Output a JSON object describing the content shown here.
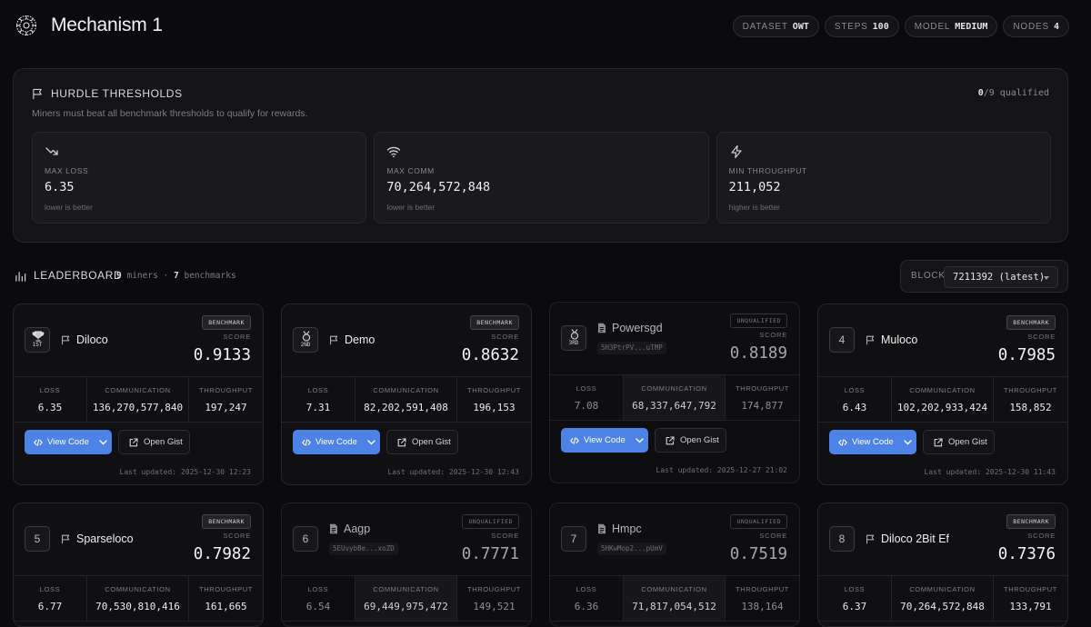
{
  "app": {
    "title": "Mechanism 1"
  },
  "pills": [
    {
      "label": "DATASET",
      "value": "OWT"
    },
    {
      "label": "STEPS",
      "value": "100"
    },
    {
      "label": "MODEL",
      "value": "MEDIUM"
    },
    {
      "label": "NODES",
      "value": "4"
    }
  ],
  "hurdle": {
    "title": "HURDLE THRESHOLDS",
    "description": "Miners must beat all benchmark thresholds to qualify for rewards.",
    "qualified_count": "0",
    "qualified_rest": "/9 qualified",
    "thresholds": [
      {
        "icon": "trending-down-icon",
        "label": "MAX LOSS",
        "value": "6.35",
        "hint": "lower is better"
      },
      {
        "icon": "wifi-icon",
        "label": "MAX COMM",
        "value": "70,264,572,848",
        "hint": "lower is better"
      },
      {
        "icon": "lightning-icon",
        "label": "MIN THROUGHPUT",
        "value": "211,052",
        "hint": "higher is better"
      }
    ]
  },
  "leaderboard": {
    "title": "LEADERBOARD",
    "miners_count": "9",
    "miners_label": "miners",
    "separator": "·",
    "benchmarks_count": "7",
    "benchmarks_label": "benchmarks",
    "block_label": "BLOCK",
    "block_value": "7211392 (latest)",
    "metric_labels": {
      "loss": "LOSS",
      "comm": "COMMUNICATION",
      "throughput": "THROUGHPUT"
    },
    "score_label": "SCORE",
    "view_code_label": "View Code",
    "open_gist_label": "Open Gist",
    "cards": [
      {
        "rank": "1ST",
        "name": "Diloco",
        "badge": "BENCHMARK",
        "score": "0.9133",
        "loss": "6.35",
        "comm": "136,270,577,840",
        "throughput": "197,247",
        "updated": "Last updated: 2025-12-30 12:23"
      },
      {
        "rank": "2ND",
        "name": "Demo",
        "badge": "BENCHMARK",
        "score": "0.8632",
        "loss": "7.31",
        "comm": "82,202,591,408",
        "throughput": "196,153",
        "updated": "Last updated: 2025-12-30 12:43"
      },
      {
        "rank": "3RD",
        "name": "Powersgd",
        "address": "5H3PtrPV...uTMP",
        "badge": "UNQUALIFIED",
        "score": "0.8189",
        "loss": "7.08",
        "comm": "68,337,647,792",
        "throughput": "174,877",
        "updated": "Last updated: 2025-12-27 21:02"
      },
      {
        "rank": "4",
        "name": "Muloco",
        "badge": "BENCHMARK",
        "score": "0.7985",
        "loss": "6.43",
        "comm": "102,202,933,424",
        "throughput": "158,852",
        "updated": "Last updated: 2025-12-30 11:43"
      },
      {
        "rank": "5",
        "name": "Sparseloco",
        "badge": "BENCHMARK",
        "score": "0.7982",
        "loss": "6.77",
        "comm": "70,530,810,416",
        "throughput": "161,665"
      },
      {
        "rank": "6",
        "name": "Aagp",
        "address": "5EUvybBe...xoZD",
        "badge": "UNQUALIFIED",
        "score": "0.7771",
        "loss": "6.54",
        "comm": "69,449,975,472",
        "throughput": "149,521"
      },
      {
        "rank": "7",
        "name": "Hmpc",
        "address": "5HKwMop2...pUmV",
        "badge": "UNQUALIFIED",
        "score": "0.7519",
        "loss": "6.36",
        "comm": "71,817,054,512",
        "throughput": "138,164"
      },
      {
        "rank": "8",
        "name": "Diloco 2Bit Ef",
        "badge": "BENCHMARK",
        "score": "0.7376",
        "loss": "6.37",
        "comm": "70,264,572,848",
        "throughput": "133,791"
      }
    ]
  },
  "colors": {
    "accent": "#4d82e6",
    "background": "#0b0b0d",
    "panel": "#141416"
  }
}
